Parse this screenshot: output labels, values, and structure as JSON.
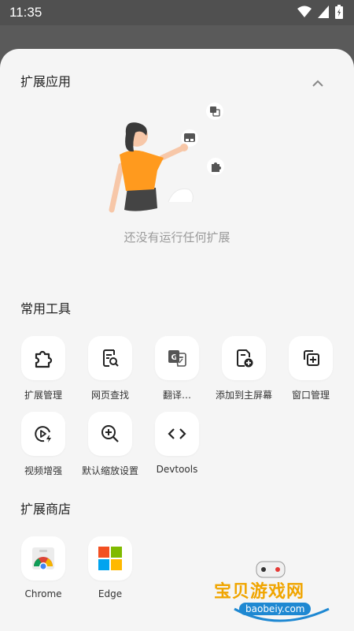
{
  "status_bar": {
    "time": "11:35"
  },
  "extensions": {
    "title": "扩展应用",
    "empty_text": "还没有运行任何扩展"
  },
  "tools": {
    "title": "常用工具",
    "items": [
      {
        "label": "扩展管理",
        "icon": "puzzle-icon"
      },
      {
        "label": "网页查找",
        "icon": "page-search-icon"
      },
      {
        "label": "翻译…",
        "icon": "translate-icon"
      },
      {
        "label": "添加到主屏幕",
        "icon": "add-to-home-icon"
      },
      {
        "label": "窗口管理",
        "icon": "window-add-icon"
      },
      {
        "label": "视频增强",
        "icon": "video-enhance-icon"
      },
      {
        "label": "默认缩放设置",
        "icon": "zoom-icon"
      },
      {
        "label": "Devtools",
        "icon": "code-icon"
      }
    ]
  },
  "store": {
    "title": "扩展商店",
    "items": [
      {
        "label": "Chrome",
        "icon": "chrome-icon"
      },
      {
        "label": "Edge",
        "icon": "edge-icon"
      }
    ]
  },
  "watermark": {
    "text": "宝贝游戏网",
    "url": "baobeiy.com"
  }
}
